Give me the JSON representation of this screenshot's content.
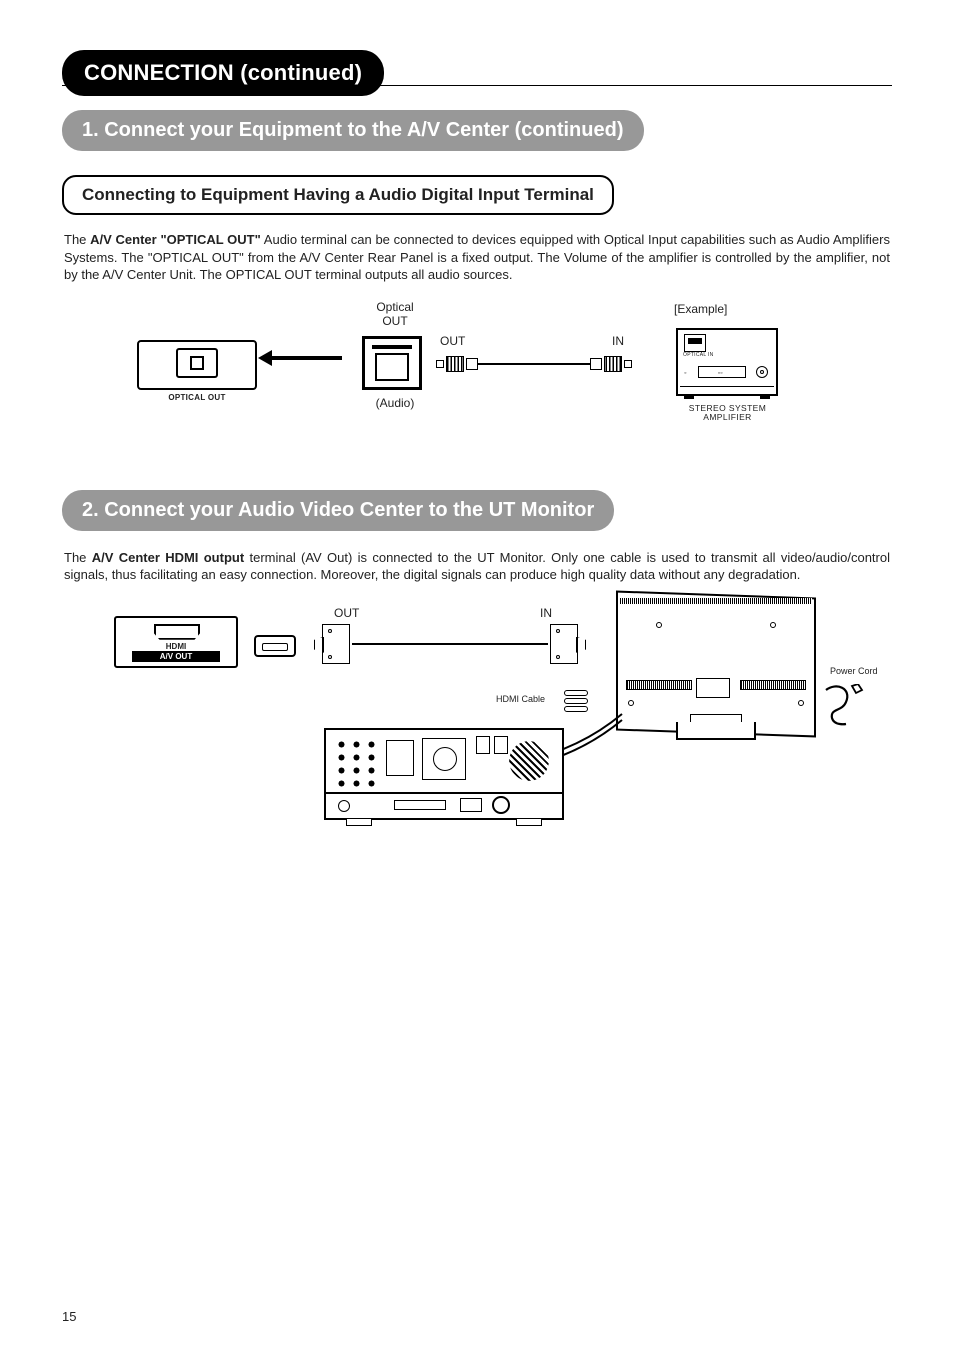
{
  "page_number": "15",
  "header": {
    "title": "CONNECTION (continued)"
  },
  "section1": {
    "title": "1. Connect your Equipment to the A/V Center (continued)",
    "sub_title": "Connecting to Equipment Having a Audio Digital Input Terminal",
    "body_prefix": "The ",
    "body_bold": "A/V Center \"OPTICAL OUT\"",
    "body_rest": " Audio terminal can be connected to devices equipped with Optical Input capabilities such as Audio Amplifiers Systems. The \"OPTICAL OUT\" from the A/V Center Rear Panel is a fixed output. The Volume of the amplifier is controlled by the amplifier, not by the A/V Center Unit. The OPTICAL OUT terminal outputs all audio sources."
  },
  "diagram1": {
    "port_label_on_panel": "OPTICAL OUT",
    "optical_out_upper": "Optical",
    "optical_out_lower": "OUT",
    "audio_label": "(Audio)",
    "cable_out": "OUT",
    "cable_in": "IN",
    "example": "[Example]",
    "amp_optical_label": "OPTICAL IN",
    "amp_caption_line1": "STEREO SYSTEM",
    "amp_caption_line2": "AMPLIFIER"
  },
  "section2": {
    "title": "2. Connect your Audio Video Center to the UT Monitor",
    "body_prefix": "The ",
    "body_bold": "A/V Center HDMI output",
    "body_rest": " terminal (AV Out) is connected to the UT Monitor. Only one cable is used to transmit all video/audio/control signals, thus facilitating an easy connection. Moreover, the digital signals can produce high quality data without any degradation."
  },
  "diagram2": {
    "panel_port_label1": "HDMI",
    "panel_port_label2": "A/V OUT",
    "cable_out": "OUT",
    "cable_in": "IN",
    "hdmi_cable_label": "HDMI Cable",
    "power_cord_label": "Power Cord"
  }
}
